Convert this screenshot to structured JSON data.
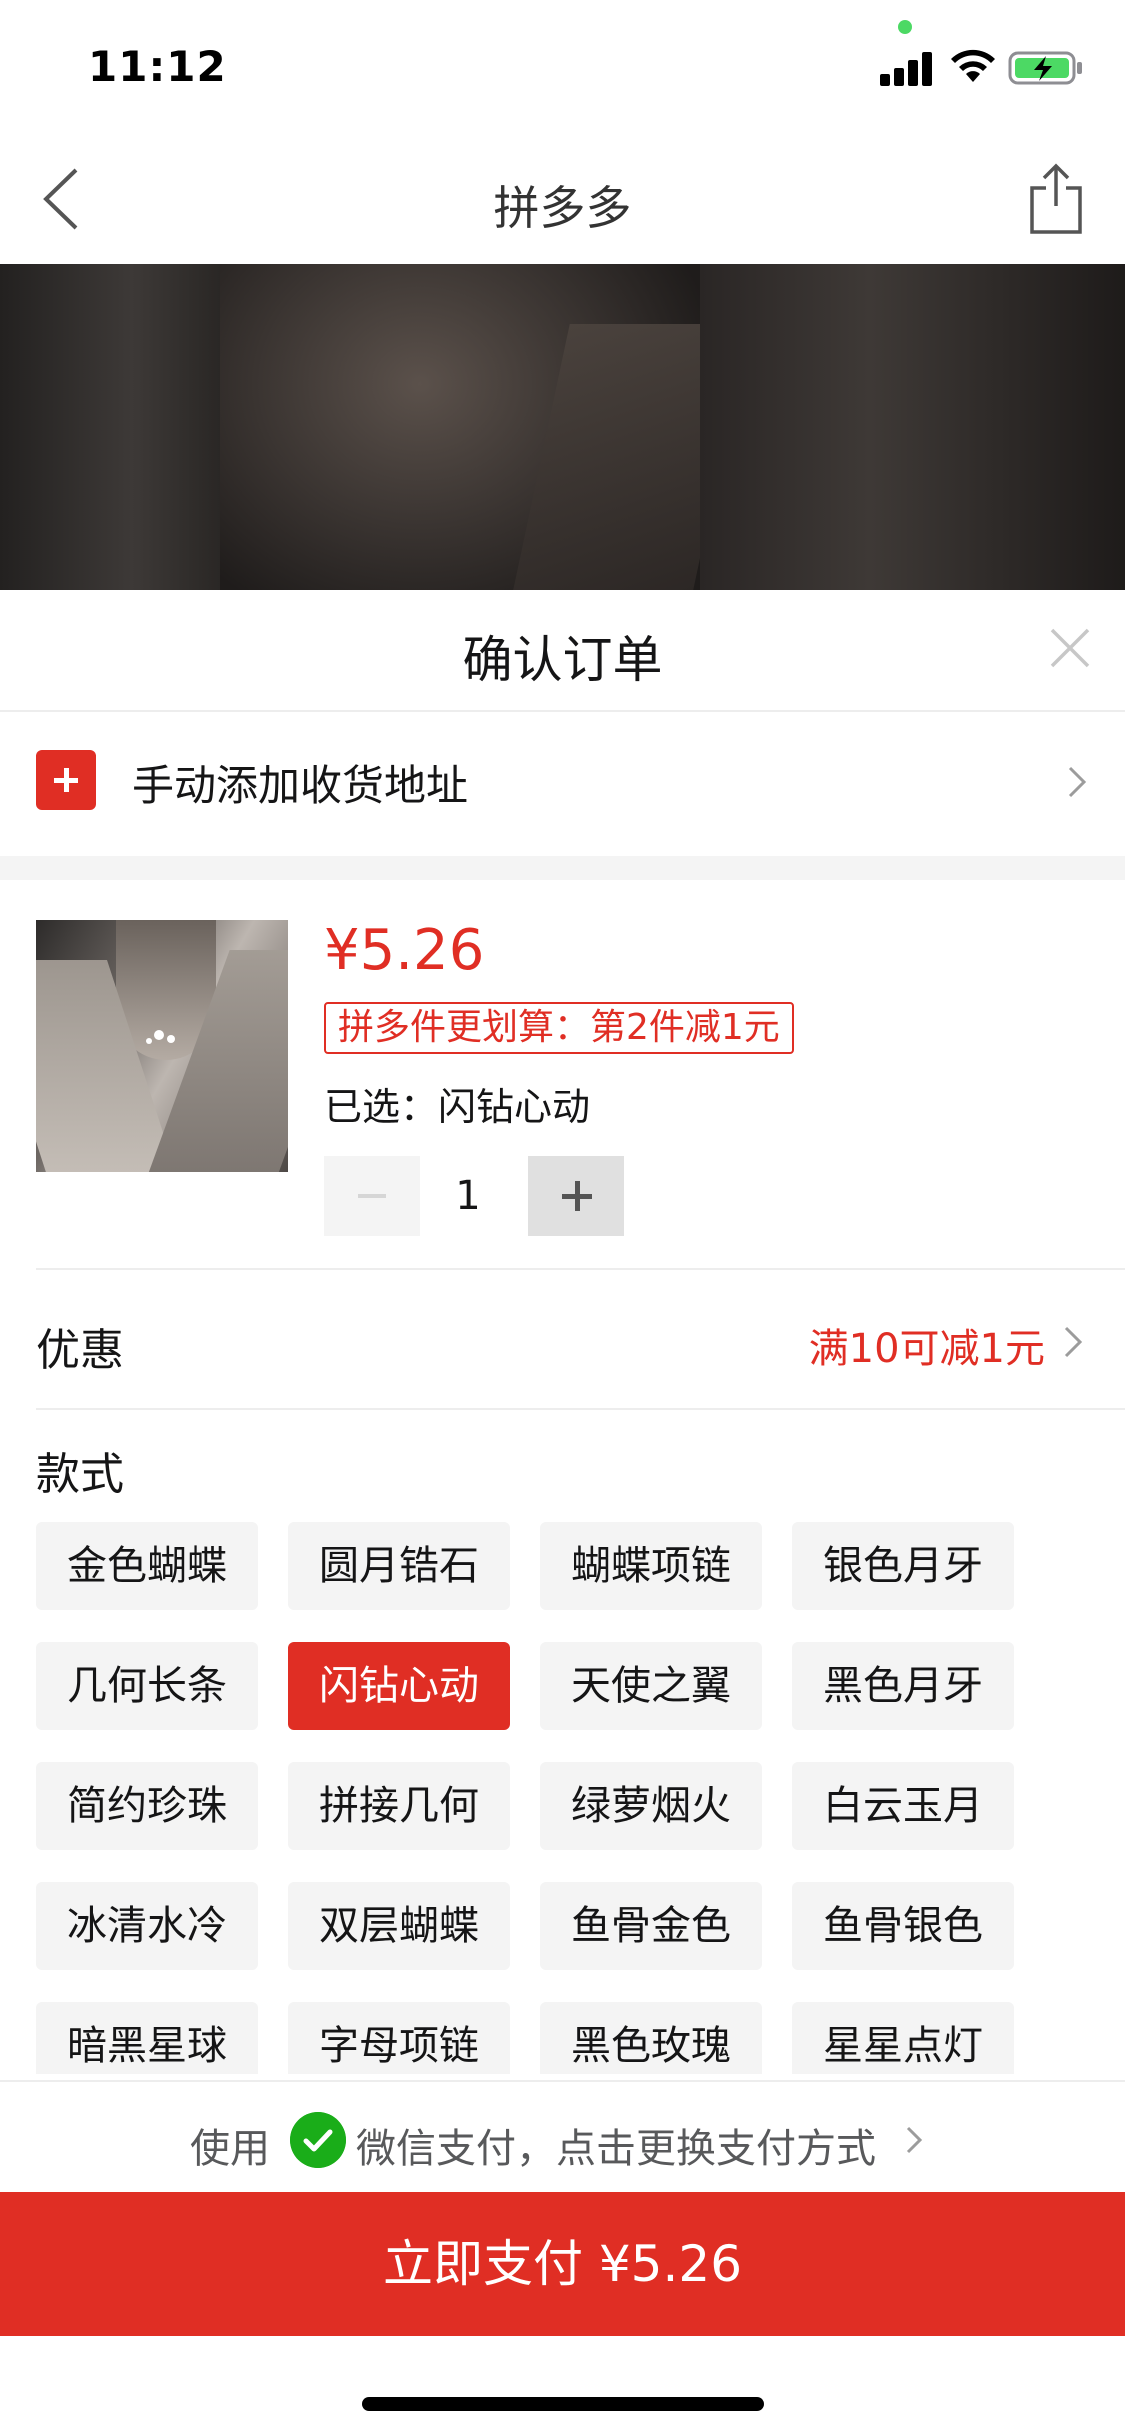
{
  "status_bar": {
    "time": "11:12"
  },
  "nav": {
    "title": "拼多多"
  },
  "sheet": {
    "title": "确认订单",
    "address": {
      "label": "手动添加收货地址"
    },
    "product": {
      "price": "¥5.26",
      "promo": "拼多件更划算：第2件减1元",
      "selected_spec": "已选：闪钻心动",
      "quantity": "1"
    },
    "discount": {
      "label": "优惠",
      "value": "满10可减1元"
    },
    "style": {
      "label": "款式",
      "options": [
        "金色蝴蝶",
        "圆月锆石",
        "蝴蝶项链",
        "银色月牙",
        "几何长条",
        "闪钻心动",
        "天使之翼",
        "黑色月牙",
        "简约珍珠",
        "拼接几何",
        "绿萝烟火",
        "白云玉月",
        "冰清水冷",
        "双层蝴蝶",
        "鱼骨金色",
        "鱼骨银色",
        "暗黑星球",
        "字母项链",
        "黑色玫瑰",
        "星星点灯"
      ],
      "selected": "闪钻心动"
    },
    "payment": {
      "prefix": "使用",
      "method_text": "微信支付，点击更换支付方式"
    },
    "pay_button": "立即支付 ¥5.26"
  },
  "colors": {
    "accent": "#e02e24",
    "wechat": "#1aad19"
  }
}
